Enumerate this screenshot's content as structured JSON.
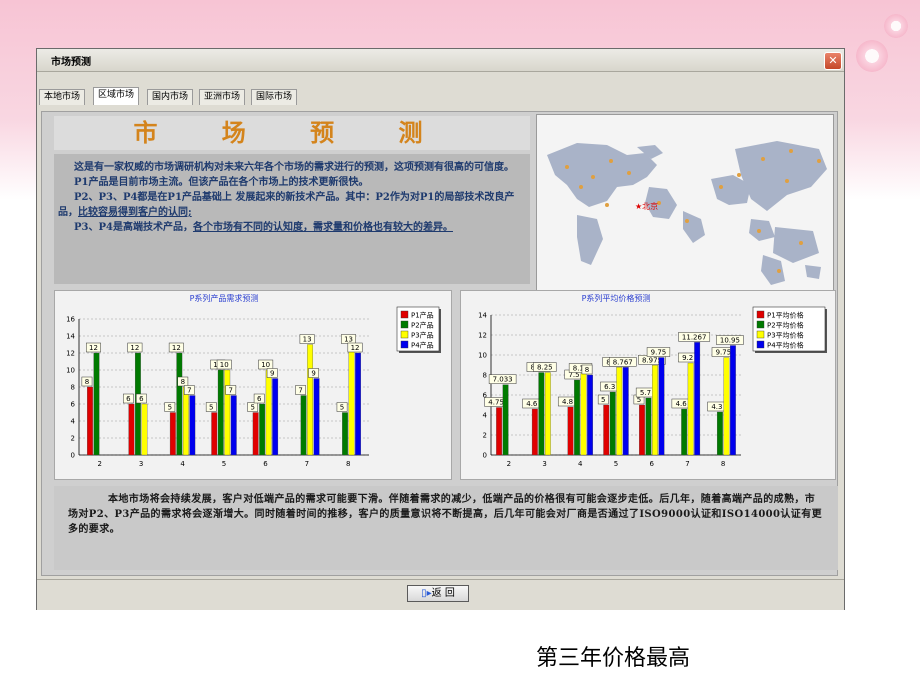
{
  "window": {
    "title": "市场预测",
    "close_label": "✕"
  },
  "tabs": [
    {
      "label": "本地市场"
    },
    {
      "label": "区域市场"
    },
    {
      "label": "国内市场"
    },
    {
      "label": "亚洲市场"
    },
    {
      "label": "国际市场"
    }
  ],
  "active_tab": 1,
  "hero_title": "市 场 预 测",
  "intro": {
    "p1": "这是有一家权威的市场调研机构对未来六年各个市场的需求进行的预测，这项预测有很高的可信度。",
    "p2": "P1产品是目前市场主流。但该产品在各个市场上的技术更新很快。",
    "p3": "P2、P3、P4都是在P1产品基础上 发展起来的新技术产品。其中：P2作为对P1的局部技术改良产品，",
    "p3_u": "比较容易得到客户的认同;",
    "p4": "P3、P4是高端技术产品，",
    "p4_u": "各个市场有不同的认知度，需求量和价格也有较大的差异。"
  },
  "map": {
    "city_label": "★北京"
  },
  "chart_data": [
    {
      "type": "bar",
      "title": "P系列产品需求预测",
      "categories": [
        "2",
        "3",
        "4",
        "5",
        "6",
        "7",
        "8"
      ],
      "ylim": [
        0,
        16
      ],
      "yticks": [
        0,
        2,
        4,
        6,
        8,
        10,
        12,
        14,
        16
      ],
      "grid": true,
      "legend": "top-right",
      "series": [
        {
          "name": "P1产品",
          "color": "#e00000",
          "values": [
            8,
            6,
            5,
            5,
            5,
            null,
            null
          ]
        },
        {
          "name": "P2产品",
          "color": "#007a00",
          "values": [
            12,
            12,
            12,
            10,
            6,
            7,
            5
          ]
        },
        {
          "name": "P3产品",
          "color": "#ffff00",
          "values": [
            null,
            6,
            8,
            10,
            10,
            13,
            13
          ]
        },
        {
          "name": "P4产品",
          "color": "#0000ee",
          "values": [
            null,
            null,
            7,
            7,
            9,
            9,
            12
          ]
        }
      ]
    },
    {
      "type": "bar",
      "title": "P系列平均价格预测",
      "categories": [
        "2",
        "3",
        "4",
        "5",
        "6",
        "7",
        "8"
      ],
      "ylim": [
        0,
        14
      ],
      "yticks": [
        0,
        2,
        4,
        6,
        8,
        10,
        12,
        14
      ],
      "grid": true,
      "legend": "top-right",
      "series": [
        {
          "name": "P1平均价格",
          "color": "#e00000",
          "values": [
            4.75,
            4.6,
            4.8,
            5,
            5,
            null,
            null
          ]
        },
        {
          "name": "P2平均价格",
          "color": "#007a00",
          "values": [
            7.033,
            8.25,
            7.5,
            6.3,
            5.7,
            4.6,
            4.3
          ]
        },
        {
          "name": "P3平均价格",
          "color": "#ffff00",
          "values": [
            null,
            8.25,
            8.15,
            8.767,
            8.975,
            9.2,
            9.75
          ]
        },
        {
          "name": "P4平均价格",
          "color": "#0000ee",
          "values": [
            null,
            null,
            8,
            8.767,
            9.75,
            11.267,
            10.95
          ]
        }
      ]
    }
  ],
  "bottom_text": "本地市场将会持续发展，客户对低端产品的需求可能要下滑。伴随着需求的减少，低端产品的价格很有可能会逐步走低。后几年，随着高端产品的成熟，市场对P2、P3产品的需求将会逐渐增大。同时随着时间的推移，客户的质量意识将不断提高，后几年可能会对厂商是否通过了ISO9000认证和ISO14000认证有更 多的要求。",
  "back_button": "返 回",
  "caption": "第三年价格最高"
}
